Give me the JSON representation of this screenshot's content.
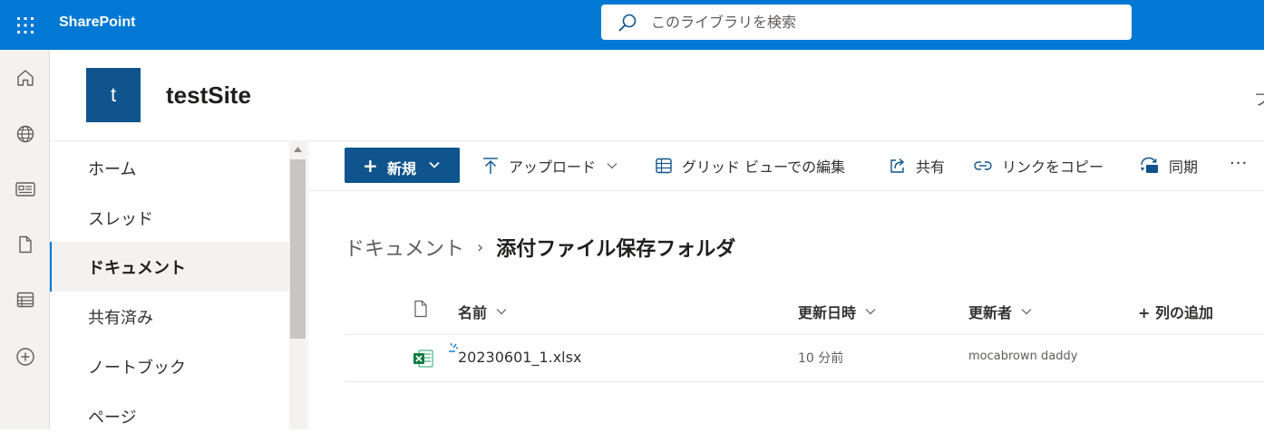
{
  "header": {
    "brand": "SharePoint",
    "search_placeholder": "このライブラリを検索"
  },
  "site": {
    "logo_letter": "t",
    "title": "testSite",
    "corner_glyph": "ブ"
  },
  "leftnav": {
    "items": [
      {
        "label": "ホーム",
        "selected": false
      },
      {
        "label": "スレッド",
        "selected": false
      },
      {
        "label": "ドキュメント",
        "selected": true
      },
      {
        "label": "共有済み",
        "selected": false
      },
      {
        "label": "ノートブック",
        "selected": false
      },
      {
        "label": "ページ",
        "selected": false
      }
    ]
  },
  "commandbar": {
    "new_label": "新規",
    "upload_label": "アップロード",
    "grid_edit_label": "グリッド ビューでの編集",
    "share_label": "共有",
    "copy_link_label": "リンクをコピー",
    "sync_label": "同期",
    "more_label": "···"
  },
  "breadcrumb": {
    "root": "ドキュメント",
    "separator": "›",
    "current": "添付ファイル保存フォルダ"
  },
  "table": {
    "columns": {
      "name": "名前",
      "modified": "更新日時",
      "modified_by": "更新者",
      "add_column": "+ 列の追加"
    },
    "rows": [
      {
        "name": "20230601_1.xlsx",
        "modified": "10 分前",
        "modified_by": "mocabrown daddy",
        "icon": "excel-file-icon",
        "new_item": true
      }
    ]
  },
  "colors": {
    "suite_bar": "#0078d4",
    "primary_button": "#0f548c",
    "site_logo": "#0f548c",
    "excel_green": "#107c41",
    "selected_nav_bg": "#f3f2f1"
  }
}
